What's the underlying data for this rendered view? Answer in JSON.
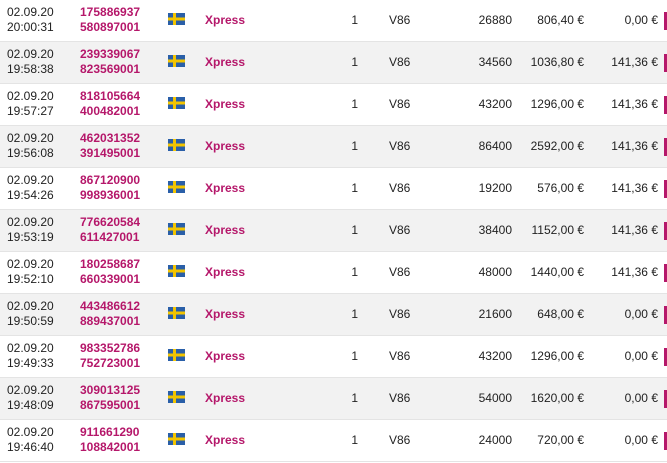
{
  "rows": [
    {
      "date": "02.09.20",
      "time": "20:00:31",
      "order_id": "175886937",
      "order_sub": "580897001",
      "flag": "sweden-flag",
      "product": "Xpress",
      "qty": "1",
      "code": "V86",
      "volume": "26880",
      "amount": "806,40 €",
      "fee": "0,00 €"
    },
    {
      "date": "02.09.20",
      "time": "19:58:38",
      "order_id": "239339067",
      "order_sub": "823569001",
      "flag": "sweden-flag",
      "product": "Xpress",
      "qty": "1",
      "code": "V86",
      "volume": "34560",
      "amount": "1036,80 €",
      "fee": "141,36 €"
    },
    {
      "date": "02.09.20",
      "time": "19:57:27",
      "order_id": "818105664",
      "order_sub": "400482001",
      "flag": "sweden-flag",
      "product": "Xpress",
      "qty": "1",
      "code": "V86",
      "volume": "43200",
      "amount": "1296,00 €",
      "fee": "141,36 €"
    },
    {
      "date": "02.09.20",
      "time": "19:56:08",
      "order_id": "462031352",
      "order_sub": "391495001",
      "flag": "sweden-flag",
      "product": "Xpress",
      "qty": "1",
      "code": "V86",
      "volume": "86400",
      "amount": "2592,00 €",
      "fee": "141,36 €"
    },
    {
      "date": "02.09.20",
      "time": "19:54:26",
      "order_id": "867120900",
      "order_sub": "998936001",
      "flag": "sweden-flag",
      "product": "Xpress",
      "qty": "1",
      "code": "V86",
      "volume": "19200",
      "amount": "576,00 €",
      "fee": "141,36 €"
    },
    {
      "date": "02.09.20",
      "time": "19:53:19",
      "order_id": "776620584",
      "order_sub": "611427001",
      "flag": "sweden-flag",
      "product": "Xpress",
      "qty": "1",
      "code": "V86",
      "volume": "38400",
      "amount": "1152,00 €",
      "fee": "141,36 €"
    },
    {
      "date": "02.09.20",
      "time": "19:52:10",
      "order_id": "180258687",
      "order_sub": "660339001",
      "flag": "sweden-flag",
      "product": "Xpress",
      "qty": "1",
      "code": "V86",
      "volume": "48000",
      "amount": "1440,00 €",
      "fee": "141,36 €"
    },
    {
      "date": "02.09.20",
      "time": "19:50:59",
      "order_id": "443486612",
      "order_sub": "889437001",
      "flag": "sweden-flag",
      "product": "Xpress",
      "qty": "1",
      "code": "V86",
      "volume": "21600",
      "amount": "648,00 €",
      "fee": "0,00 €"
    },
    {
      "date": "02.09.20",
      "time": "19:49:33",
      "order_id": "983352786",
      "order_sub": "752723001",
      "flag": "sweden-flag",
      "product": "Xpress",
      "qty": "1",
      "code": "V86",
      "volume": "43200",
      "amount": "1296,00 €",
      "fee": "0,00 €"
    },
    {
      "date": "02.09.20",
      "time": "19:48:09",
      "order_id": "309013125",
      "order_sub": "867595001",
      "flag": "sweden-flag",
      "product": "Xpress",
      "qty": "1",
      "code": "V86",
      "volume": "54000",
      "amount": "1620,00 €",
      "fee": "0,00 €"
    },
    {
      "date": "02.09.20",
      "time": "19:46:40",
      "order_id": "911661290",
      "order_sub": "108842001",
      "flag": "sweden-flag",
      "product": "Xpress",
      "qty": "1",
      "code": "V86",
      "volume": "24000",
      "amount": "720,00 €",
      "fee": "0,00 €"
    }
  ],
  "colors": {
    "accent": "#b5176a",
    "row_alt": "#f2f2f2",
    "flag_blue": "#2a5fa8",
    "flag_yellow": "#f2c400"
  }
}
